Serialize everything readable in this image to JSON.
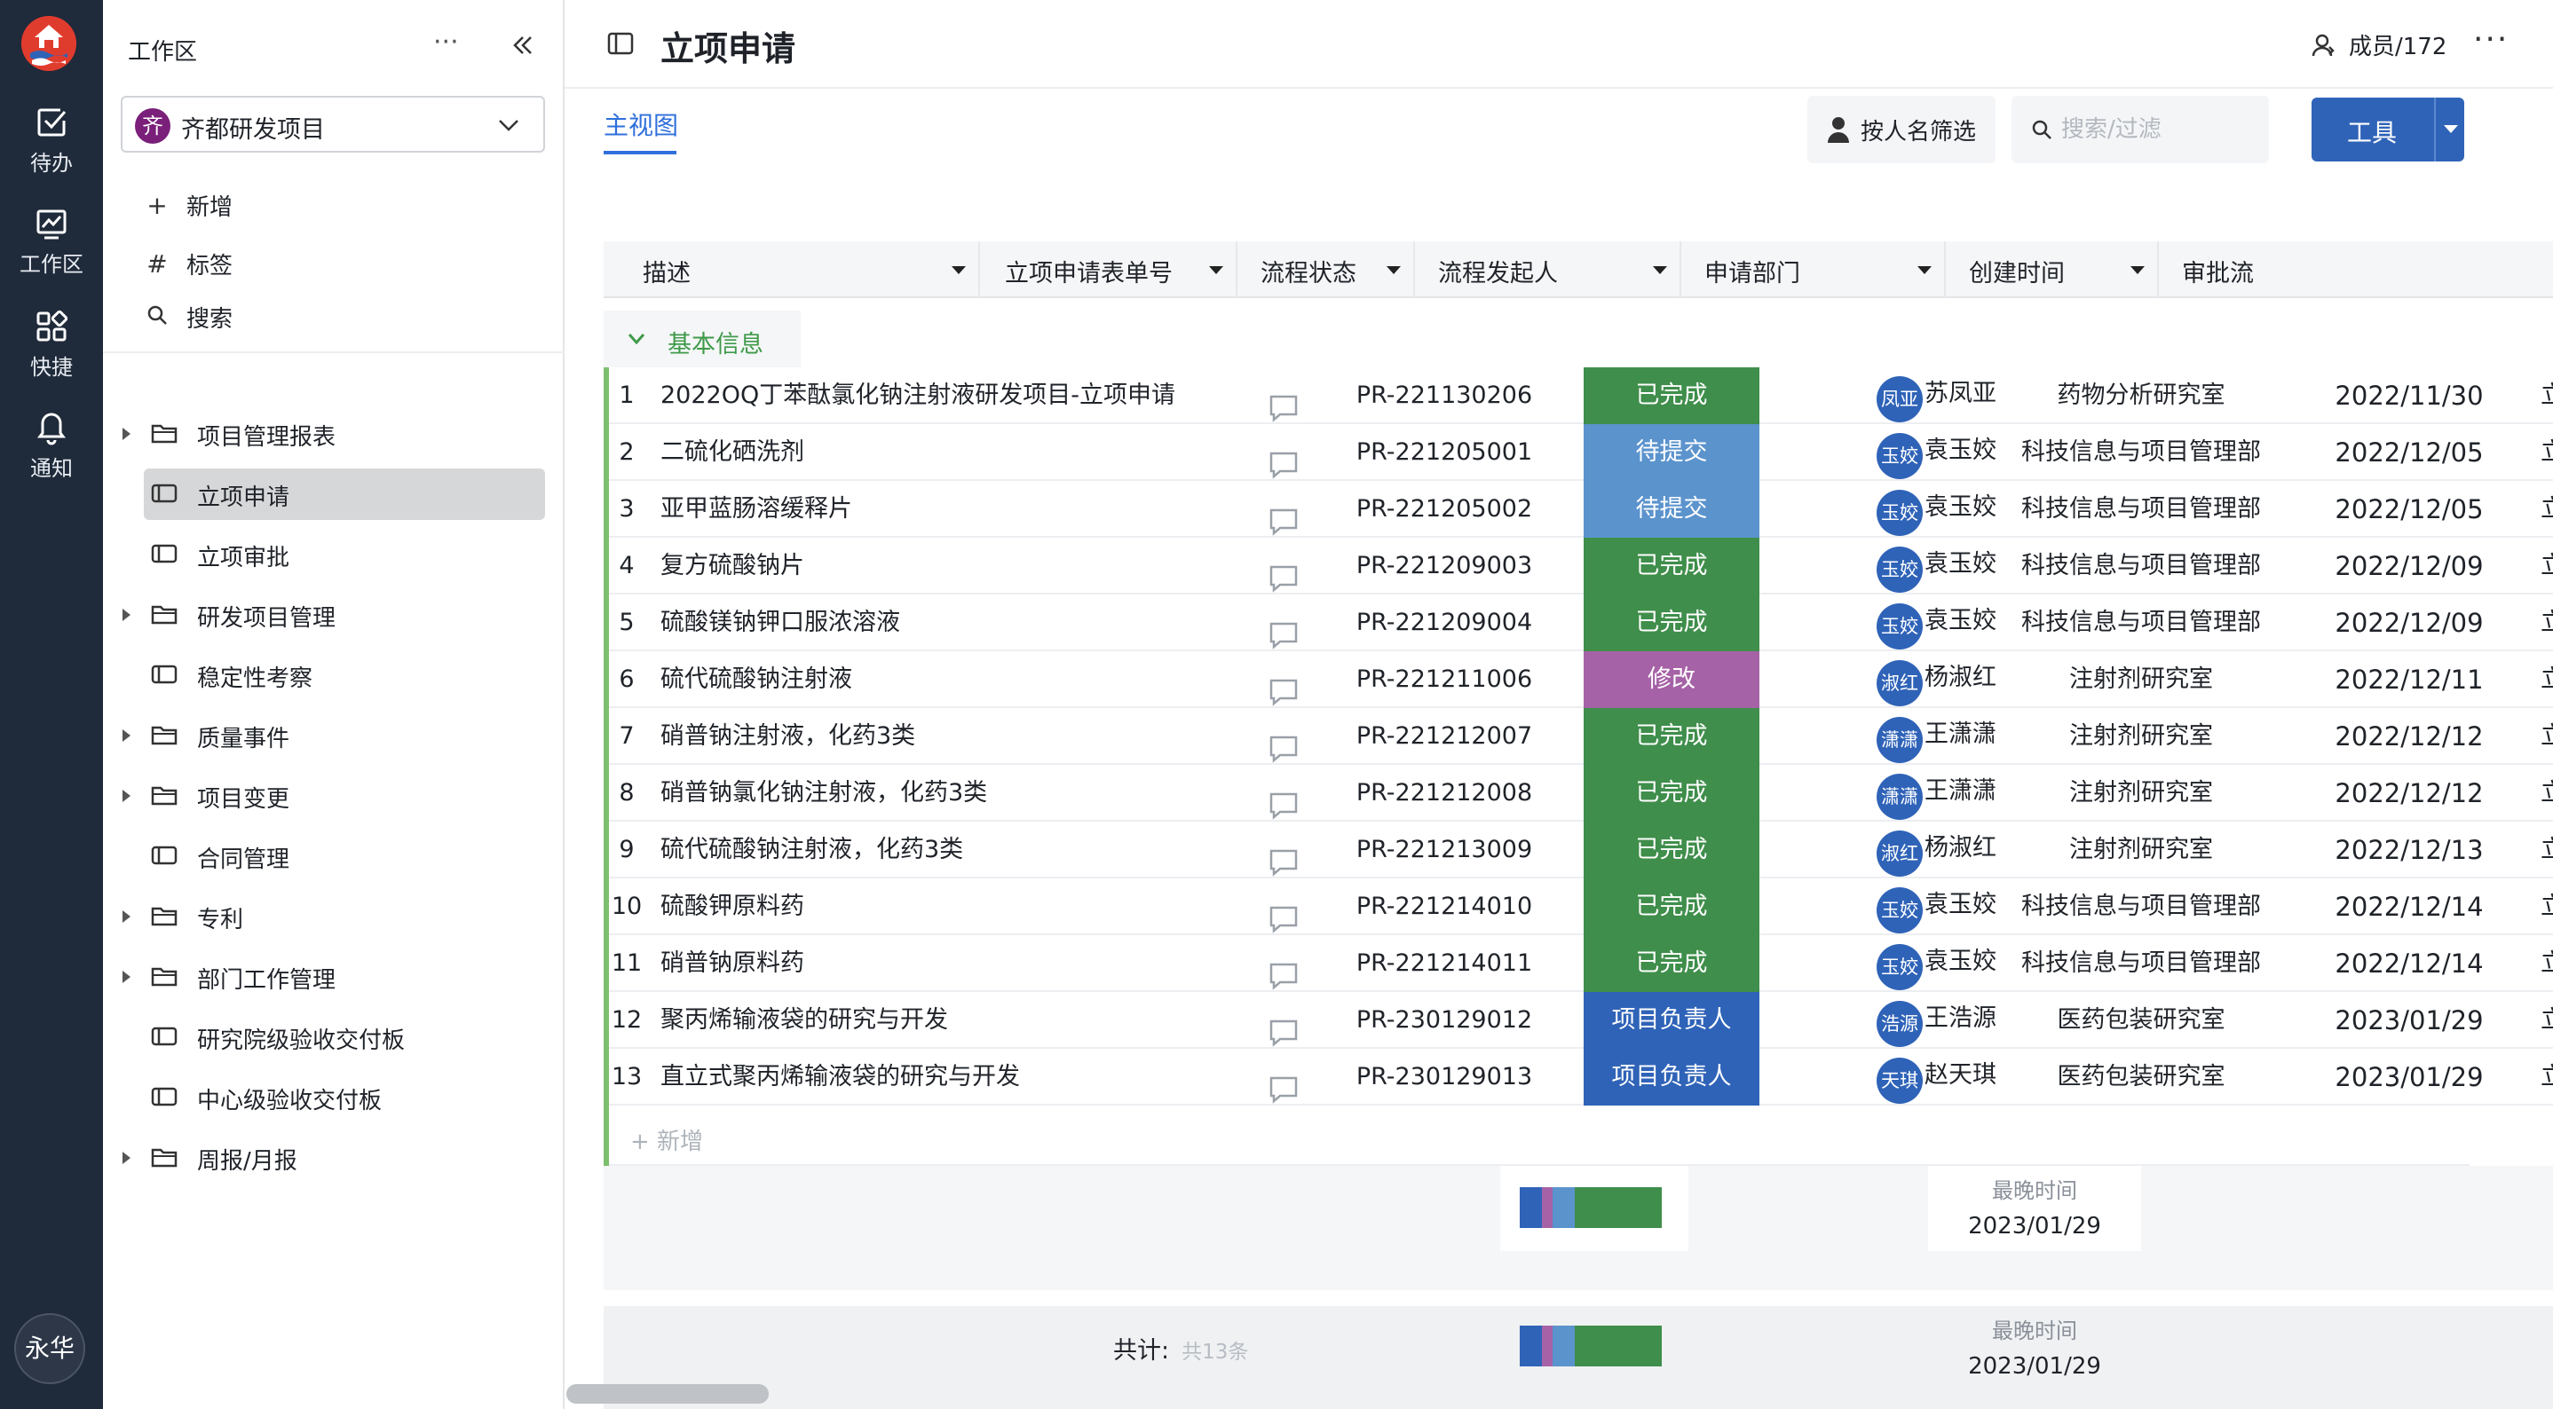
{
  "rail": {
    "items": [
      {
        "label": "待办",
        "icon": "todo-check-icon"
      },
      {
        "label": "工作区",
        "icon": "workspace-chart-icon"
      },
      {
        "label": "快捷",
        "icon": "shortcut-grid-icon"
      },
      {
        "label": "通知",
        "icon": "bell-icon"
      }
    ],
    "user_avatar": "永华"
  },
  "sidebar": {
    "workspace_label": "工作区",
    "more": "···",
    "project": {
      "badge": "齐",
      "name": "齐都研发项目",
      "badge_color": "#7a1f7a"
    },
    "actions": [
      {
        "icon": "+",
        "label": "新增"
      },
      {
        "icon": "#",
        "label": "标签"
      },
      {
        "icon": "⚲",
        "label": "搜索"
      }
    ],
    "tree": [
      {
        "label": "项目管理报表",
        "type": "folder",
        "expandable": true
      },
      {
        "label": "立项申请",
        "type": "table",
        "expandable": false,
        "active": true
      },
      {
        "label": "立项审批",
        "type": "table",
        "expandable": false
      },
      {
        "label": "研发项目管理",
        "type": "folder",
        "expandable": true
      },
      {
        "label": "稳定性考察",
        "type": "table",
        "expandable": false
      },
      {
        "label": "质量事件",
        "type": "folder",
        "expandable": true
      },
      {
        "label": "项目变更",
        "type": "folder",
        "expandable": true
      },
      {
        "label": "合同管理",
        "type": "table",
        "expandable": false
      },
      {
        "label": "专利",
        "type": "folder",
        "expandable": true
      },
      {
        "label": "部门工作管理",
        "type": "folder",
        "expandable": true
      },
      {
        "label": "研究院级验收交付板",
        "type": "table",
        "expandable": false
      },
      {
        "label": "中心级验收交付板",
        "type": "table",
        "expandable": false
      },
      {
        "label": "周报/月报",
        "type": "folder",
        "expandable": true
      }
    ]
  },
  "header": {
    "title": "立项申请",
    "members": "成员/172",
    "more": "···"
  },
  "toolbar": {
    "view_tab": "主视图",
    "filter_by_person": "按人名筛选",
    "search_placeholder": "搜索/过滤",
    "tools": "工具"
  },
  "table": {
    "columns": [
      "描述",
      "立项申请表单号",
      "流程状态",
      "流程发起人",
      "申请部门",
      "创建时间",
      "审批流"
    ],
    "group": "基本信息",
    "status_colors": {
      "已完成": "#3f8e4b",
      "待提交": "#5b93cd",
      "修改": "#a662a6",
      "项目负责人": "#2f63b8"
    },
    "rows": [
      {
        "idx": "1",
        "desc": "2022OQ丁苯酞氯化钠注射液研发项目-立项申请",
        "no": "PR-221130206",
        "status": "已完成",
        "avatar": "凤亚",
        "avatar_color": "#2f63b8",
        "name": "苏凤亚",
        "dept": "药物分析研究室",
        "date": "2022/11/30",
        "flow": "立项申"
      },
      {
        "idx": "2",
        "desc": "二硫化硒洗剂",
        "no": "PR-221205001",
        "status": "待提交",
        "avatar": "玉姣",
        "avatar_color": "#2f63b8",
        "name": "袁玉姣",
        "dept": "科技信息与项目管理部",
        "date": "2022/12/05",
        "flow": "立项申"
      },
      {
        "idx": "3",
        "desc": "亚甲蓝肠溶缓释片",
        "no": "PR-221205002",
        "status": "待提交",
        "avatar": "玉姣",
        "avatar_color": "#2f63b8",
        "name": "袁玉姣",
        "dept": "科技信息与项目管理部",
        "date": "2022/12/05",
        "flow": "立项申"
      },
      {
        "idx": "4",
        "desc": "复方硫酸钠片",
        "no": "PR-221209003",
        "status": "已完成",
        "avatar": "玉姣",
        "avatar_color": "#2f63b8",
        "name": "袁玉姣",
        "dept": "科技信息与项目管理部",
        "date": "2022/12/09",
        "flow": "立项申"
      },
      {
        "idx": "5",
        "desc": "硫酸镁钠钾口服浓溶液",
        "no": "PR-221209004",
        "status": "已完成",
        "avatar": "玉姣",
        "avatar_color": "#2f63b8",
        "name": "袁玉姣",
        "dept": "科技信息与项目管理部",
        "date": "2022/12/09",
        "flow": "立项申"
      },
      {
        "idx": "6",
        "desc": "硫代硫酸钠注射液",
        "no": "PR-221211006",
        "status": "修改",
        "avatar": "淑红",
        "avatar_color": "#2f63b8",
        "name": "杨淑红",
        "dept": "注射剂研究室",
        "date": "2022/12/11",
        "flow": "立项申"
      },
      {
        "idx": "7",
        "desc": "硝普钠注射液，化药3类",
        "no": "PR-221212007",
        "status": "已完成",
        "avatar": "潇潇",
        "avatar_color": "#2f63b8",
        "name": "王潇潇",
        "dept": "注射剂研究室",
        "date": "2022/12/12",
        "flow": "立项申"
      },
      {
        "idx": "8",
        "desc": "硝普钠氯化钠注射液，化药3类",
        "no": "PR-221212008",
        "status": "已完成",
        "avatar": "潇潇",
        "avatar_color": "#2f63b8",
        "name": "王潇潇",
        "dept": "注射剂研究室",
        "date": "2022/12/12",
        "flow": "立项申"
      },
      {
        "idx": "9",
        "desc": "硫代硫酸钠注射液，化药3类",
        "no": "PR-221213009",
        "status": "已完成",
        "avatar": "淑红",
        "avatar_color": "#2f63b8",
        "name": "杨淑红",
        "dept": "注射剂研究室",
        "date": "2022/12/13",
        "flow": "立项申"
      },
      {
        "idx": "10",
        "desc": "硫酸钾原料药",
        "no": "PR-221214010",
        "status": "已完成",
        "avatar": "玉姣",
        "avatar_color": "#2f63b8",
        "name": "袁玉姣",
        "dept": "科技信息与项目管理部",
        "date": "2022/12/14",
        "flow": "立项申"
      },
      {
        "idx": "11",
        "desc": "硝普钠原料药",
        "no": "PR-221214011",
        "status": "已完成",
        "avatar": "玉姣",
        "avatar_color": "#2f63b8",
        "name": "袁玉姣",
        "dept": "科技信息与项目管理部",
        "date": "2022/12/14",
        "flow": "立项申"
      },
      {
        "idx": "12",
        "desc": "聚丙烯输液袋的研究与开发",
        "no": "PR-230129012",
        "status": "项目负责人",
        "avatar": "浩源",
        "avatar_color": "#2f63b8",
        "name": "王浩源",
        "dept": "医药包装研究室",
        "date": "2023/01/29",
        "flow": "立项申"
      },
      {
        "idx": "13",
        "desc": "直立式聚丙烯输液袋的研究与开发",
        "no": "PR-230129013",
        "status": "项目负责人",
        "avatar": "天琪",
        "avatar_color": "#2f63b8",
        "name": "赵天琪",
        "dept": "医药包装研究室",
        "date": "2023/01/29",
        "flow": "立项申"
      }
    ],
    "add_row": "+ 新增",
    "group_stats": {
      "latest_label": "最晚时间",
      "latest_value": "2023/01/29"
    },
    "footer": {
      "total_label": "共计:",
      "total_count": "共13条",
      "latest_label": "最晚时间",
      "latest_value": "2023/01/29"
    },
    "status_distribution": [
      {
        "status": "项目负责人",
        "fraction": 0.154
      },
      {
        "status": "修改",
        "fraction": 0.077
      },
      {
        "status": "待提交",
        "fraction": 0.154
      },
      {
        "status": "已完成",
        "fraction": 0.615
      }
    ]
  }
}
